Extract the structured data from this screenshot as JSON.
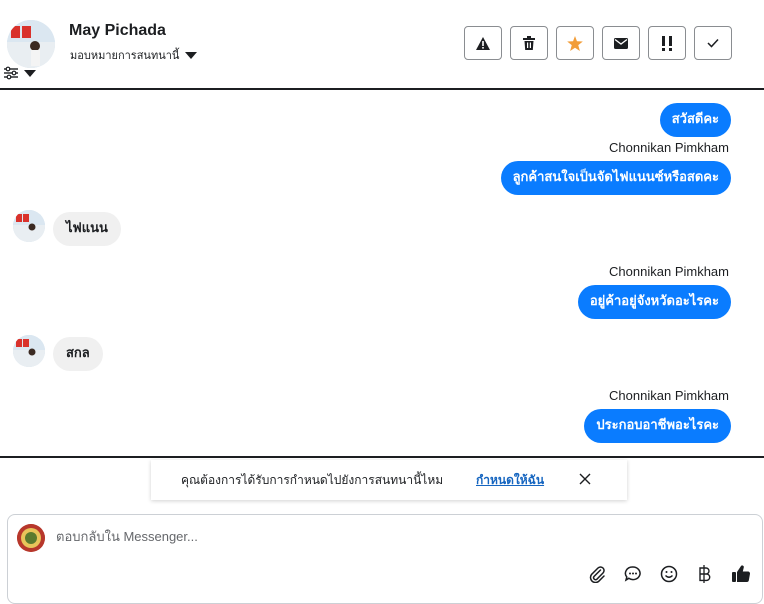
{
  "contact": {
    "name": "May Pichada",
    "assign_label": "มอบหมายการสนทนานี้"
  },
  "toolbar": {
    "buttons": [
      {
        "name": "spam",
        "icon": "alert-triangle-icon"
      },
      {
        "name": "delete",
        "icon": "trash-icon"
      },
      {
        "name": "star",
        "icon": "star-icon"
      },
      {
        "name": "unread",
        "icon": "envelope-icon"
      },
      {
        "name": "follow-up",
        "icon": "exclamation-icon"
      },
      {
        "name": "done",
        "icon": "check-icon"
      }
    ],
    "star_color": "#f29d38"
  },
  "messages": {
    "m1": "สวัสดีคะ",
    "sender1": "Chonnikan Pimkham",
    "m2": "ลูกค้าสนใจเป็นจัดไฟแนนซ์หรือสดคะ",
    "m3": "ไฟแนน",
    "sender2": "Chonnikan Pimkham",
    "m4": "อยู่ค้าอยู่จังหวัดอะไรคะ",
    "m5": "สกล",
    "sender3": "Chonnikan Pimkham",
    "m6": "ประกอบอาชีพอะไรคะ"
  },
  "notice": {
    "text": "คุณต้องการได้รับการกำหนดไปยังการสนทนานี้ไหม",
    "link": "กำหนดให้ฉัน"
  },
  "composer": {
    "placeholder": "ตอบกลับใน Messenger..."
  },
  "colors": {
    "outgoing_bubble": "#0a7cff",
    "incoming_bubble": "#f0f0f0",
    "link": "#1565c0"
  }
}
